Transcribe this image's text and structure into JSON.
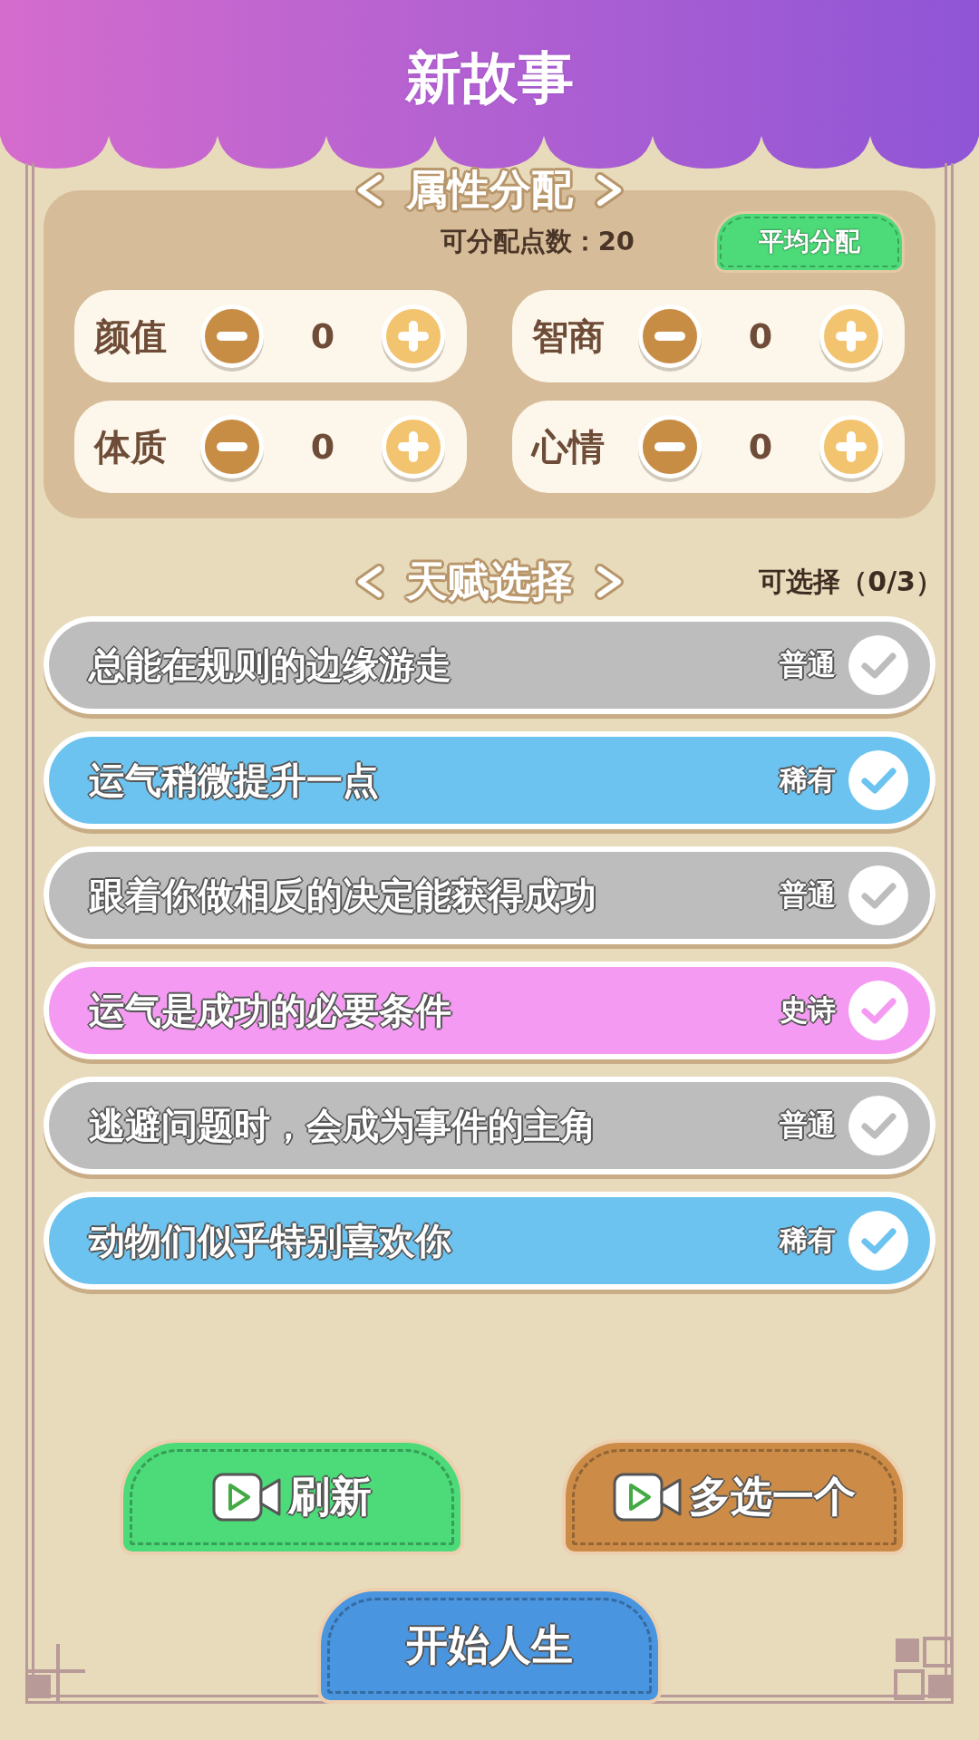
{
  "header": {
    "title": "新故事"
  },
  "attributes": {
    "section_title": "属性分配",
    "points_label": "可分配点数：20",
    "average_button": "平均分配",
    "items": [
      {
        "label": "颜值",
        "value": "0"
      },
      {
        "label": "智商",
        "value": "0"
      },
      {
        "label": "体质",
        "value": "0"
      },
      {
        "label": "心情",
        "value": "0"
      }
    ]
  },
  "talents": {
    "section_title": "天赋选择",
    "count": "可选择（0/3）",
    "items": [
      {
        "text": "总能在规则的边缘游走",
        "rarity": "普通",
        "color": "#bdbdbd"
      },
      {
        "text": "运气稍微提升一点",
        "rarity": "稀有",
        "color": "#6cc3ef"
      },
      {
        "text": "跟着你做相反的决定能获得成功",
        "rarity": "普通",
        "color": "#bdbdbd"
      },
      {
        "text": "运气是成功的必要条件",
        "rarity": "史诗",
        "color": "#f59af3"
      },
      {
        "text": "逃避问题时，会成为事件的主角",
        "rarity": "普通",
        "color": "#bdbdbd"
      },
      {
        "text": "动物们似乎特别喜欢你",
        "rarity": "稀有",
        "color": "#6cc3ef"
      }
    ]
  },
  "actions": [
    {
      "label": "刷新",
      "kind": "video",
      "color": "#4cdb78"
    },
    {
      "label": "多选一个",
      "kind": "video",
      "color": "#cc8c48"
    },
    {
      "label": "开始人生",
      "kind": "plain",
      "color": "#4a95e0"
    }
  ]
}
